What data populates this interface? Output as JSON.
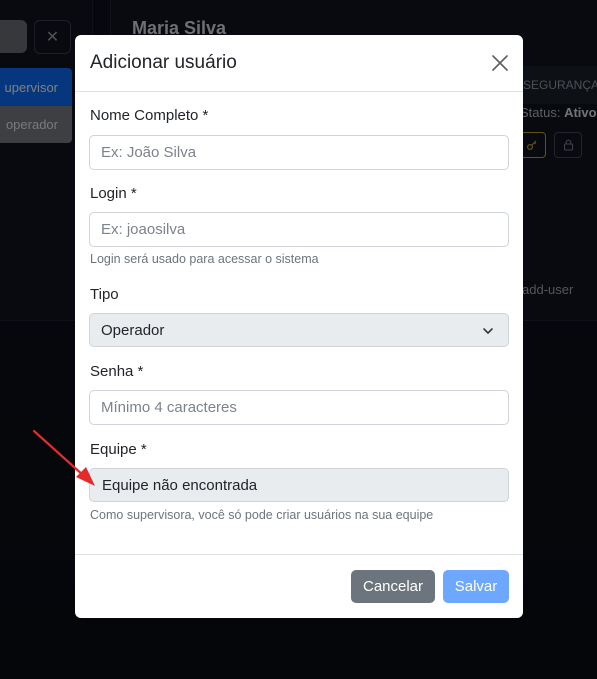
{
  "background": {
    "filter_close": "✕",
    "sidebar_items": [
      "upervisor",
      "operador"
    ],
    "user_name": "Maria Silva",
    "section_label": "SEGURANÇA",
    "status_label": "Status:",
    "status_value": "Ativo",
    "tag": "add-user"
  },
  "modal": {
    "title": "Adicionar usuário",
    "fields": {
      "name": {
        "label": "Nome Completo *",
        "placeholder": "Ex: João Silva"
      },
      "login": {
        "label": "Login *",
        "placeholder": "Ex: joaosilva",
        "help": "Login será usado para acessar o sistema"
      },
      "type": {
        "label": "Tipo",
        "selected": "Operador"
      },
      "password": {
        "label": "Senha *",
        "placeholder": "Mínimo 4 caracteres"
      },
      "team": {
        "label": "Equipe *",
        "value": "Equipe não encontrada",
        "help": "Como supervisora, você só pode criar usuários na sua equipe"
      }
    },
    "buttons": {
      "cancel": "Cancelar",
      "save": "Salvar"
    }
  },
  "colors": {
    "primary": "#0d6efd",
    "save_disabled": "#6ea8fe",
    "secondary": "#6c757d",
    "annotation_arrow": "#e32b2b"
  }
}
